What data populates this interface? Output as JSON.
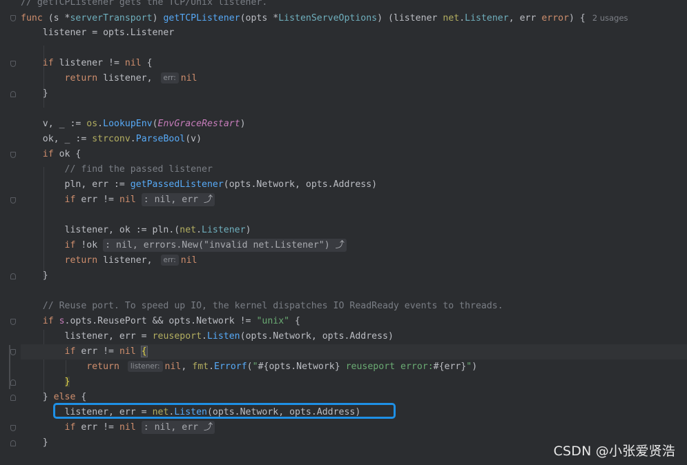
{
  "editor": {
    "lines": [
      {
        "id": "l0",
        "segments": [
          [
            "cm",
            "// getTCPListener gets the TCP/Unix listener."
          ]
        ]
      },
      {
        "id": "l1",
        "segments": [
          [
            "kw",
            "func "
          ],
          [
            "t",
            "(s *"
          ],
          [
            "ty",
            "serverTransport"
          ],
          [
            "t",
            ") "
          ],
          [
            "fn",
            "getTCPListener"
          ],
          [
            "t",
            "(opts *"
          ],
          [
            "ty",
            "ListenServeOptions"
          ],
          [
            "t",
            ") (listener "
          ],
          [
            "pkgname",
            "net"
          ],
          [
            "t",
            "."
          ],
          [
            "ty",
            "Listener"
          ],
          [
            "t",
            ", err "
          ],
          [
            "kw",
            "error"
          ],
          [
            "t",
            ") {"
          ]
        ],
        "usages": "2 usages"
      },
      {
        "id": "l2",
        "segments": [
          [
            "t",
            "    listener = opts.Listener"
          ]
        ]
      },
      {
        "id": "l3",
        "segments": []
      },
      {
        "id": "l4",
        "segments": [
          [
            "t",
            "    "
          ],
          [
            "kw",
            "if "
          ],
          [
            "t",
            "listener != "
          ],
          [
            "kw",
            "nil "
          ],
          [
            "t",
            "{"
          ]
        ]
      },
      {
        "id": "l5",
        "segments": [
          [
            "t",
            "        "
          ],
          [
            "kw",
            "return "
          ],
          [
            "t",
            "listener, "
          ],
          [
            "hint",
            "err:"
          ],
          [
            "kw",
            "nil"
          ]
        ]
      },
      {
        "id": "l6",
        "segments": [
          [
            "t",
            "    }"
          ]
        ]
      },
      {
        "id": "l7",
        "segments": []
      },
      {
        "id": "l8",
        "segments": [
          [
            "t",
            "    v, _ := "
          ],
          [
            "pkgname",
            "os"
          ],
          [
            "t",
            "."
          ],
          [
            "call",
            "LookupEnv"
          ],
          [
            "t",
            "("
          ],
          [
            "cn",
            "EnvGraceRestart"
          ],
          [
            "t",
            ")"
          ]
        ]
      },
      {
        "id": "l9",
        "segments": [
          [
            "t",
            "    ok, _ := "
          ],
          [
            "pkgname",
            "strconv"
          ],
          [
            "t",
            "."
          ],
          [
            "call",
            "ParseBool"
          ],
          [
            "t",
            "(v)"
          ]
        ]
      },
      {
        "id": "l10",
        "segments": [
          [
            "t",
            "    "
          ],
          [
            "kw",
            "if "
          ],
          [
            "t",
            "ok {"
          ]
        ]
      },
      {
        "id": "l11",
        "segments": [
          [
            "t",
            "        "
          ],
          [
            "cm",
            "// find the passed listener"
          ]
        ]
      },
      {
        "id": "l12",
        "segments": [
          [
            "t",
            "        pln, err := "
          ],
          [
            "call",
            "getPassedListener"
          ],
          [
            "t",
            "(opts.Network, opts.Address)"
          ]
        ]
      },
      {
        "id": "l13",
        "segments": [
          [
            "t",
            "        "
          ],
          [
            "kw",
            "if "
          ],
          [
            "t",
            "err != "
          ],
          [
            "kw",
            "nil "
          ],
          [
            "fold",
            ": nil, err ⤴"
          ]
        ]
      },
      {
        "id": "l14",
        "segments": []
      },
      {
        "id": "l15",
        "segments": [
          [
            "t",
            "        listener, ok := pln.("
          ],
          [
            "pkgname",
            "net"
          ],
          [
            "t",
            "."
          ],
          [
            "ty",
            "Listener"
          ],
          [
            "t",
            ")"
          ]
        ]
      },
      {
        "id": "l16",
        "segments": [
          [
            "t",
            "        "
          ],
          [
            "kw",
            "if "
          ],
          [
            "t",
            "!ok "
          ],
          [
            "fold",
            ": nil, errors.New(\"invalid net.Listener\") ⤴"
          ]
        ]
      },
      {
        "id": "l17",
        "segments": [
          [
            "t",
            "        "
          ],
          [
            "kw",
            "return "
          ],
          [
            "t",
            "listener, "
          ],
          [
            "hint",
            "err:"
          ],
          [
            "kw",
            "nil"
          ]
        ]
      },
      {
        "id": "l18",
        "segments": [
          [
            "t",
            "    }"
          ]
        ]
      },
      {
        "id": "l19",
        "segments": []
      },
      {
        "id": "l20",
        "segments": [
          [
            "t",
            "    "
          ],
          [
            "cm",
            "// Reuse port. To speed up IO, the kernel dispatches IO ReadReady events to threads."
          ]
        ]
      },
      {
        "id": "l21",
        "segments": [
          [
            "t",
            "    "
          ],
          [
            "kw",
            "if "
          ],
          [
            "fielddec",
            "s"
          ],
          [
            "t",
            ".opts.ReusePort && opts.Network != "
          ],
          [
            "str",
            "\"unix\""
          ],
          [
            "t",
            " {"
          ]
        ]
      },
      {
        "id": "l22",
        "segments": [
          [
            "t",
            "        listener, err = "
          ],
          [
            "pkgname",
            "reuseport"
          ],
          [
            "t",
            "."
          ],
          [
            "call",
            "Listen"
          ],
          [
            "t",
            "(opts.Network, opts.Address)"
          ]
        ]
      },
      {
        "id": "l23",
        "segments": [
          [
            "t",
            "        "
          ],
          [
            "kw",
            "if "
          ],
          [
            "t",
            "err != "
          ],
          [
            "kw",
            "nil "
          ],
          [
            "brm",
            "{"
          ]
        ],
        "current": true
      },
      {
        "id": "l24",
        "segments": [
          [
            "t",
            "            "
          ],
          [
            "kw",
            "return "
          ],
          [
            "hint",
            "listener:"
          ],
          [
            "kw",
            "nil"
          ],
          [
            "t",
            ", "
          ],
          [
            "pkgname",
            "fmt"
          ],
          [
            "t",
            "."
          ],
          [
            "call",
            "Errorf"
          ],
          [
            "t",
            "("
          ],
          [
            "str",
            "\""
          ],
          [
            "t",
            "#{opts.Network}"
          ],
          [
            "str",
            " reuseport error:"
          ],
          [
            "t",
            "#{err}"
          ],
          [
            "str",
            "\""
          ],
          [
            "t",
            ")"
          ]
        ]
      },
      {
        "id": "l25",
        "segments": [
          [
            "t",
            "        "
          ],
          [
            "bry",
            "}"
          ]
        ]
      },
      {
        "id": "l26",
        "segments": [
          [
            "t",
            "    } "
          ],
          [
            "kw",
            "else "
          ],
          [
            "t",
            "{"
          ]
        ]
      },
      {
        "id": "l27",
        "segments": [
          [
            "t",
            "        listener, err = "
          ],
          [
            "pkgname",
            "net"
          ],
          [
            "t",
            "."
          ],
          [
            "call",
            "Listen"
          ],
          [
            "t",
            "(opts.Network, opts.Address)"
          ]
        ]
      },
      {
        "id": "l28",
        "segments": [
          [
            "t",
            "        "
          ],
          [
            "kw",
            "if "
          ],
          [
            "t",
            "err != "
          ],
          [
            "kw",
            "nil "
          ],
          [
            "fold",
            ": nil, err ⤴"
          ]
        ]
      },
      {
        "id": "l29",
        "segments": [
          [
            "t",
            "    }"
          ]
        ]
      }
    ],
    "folds": [
      {
        "line": 1,
        "dir": "down"
      },
      {
        "line": 4,
        "dir": "down"
      },
      {
        "line": 6,
        "dir": "up"
      },
      {
        "line": 10,
        "dir": "down"
      },
      {
        "line": 13,
        "dir": "down"
      },
      {
        "line": 18,
        "dir": "up"
      },
      {
        "line": 21,
        "dir": "down"
      },
      {
        "line": 23,
        "dir": "down"
      },
      {
        "line": 25,
        "dir": "up"
      },
      {
        "line": 26,
        "dir": "up"
      },
      {
        "line": 28,
        "dir": "down"
      },
      {
        "line": 29,
        "dir": "up"
      }
    ]
  },
  "watermark": "CSDN @小张爱贤浩"
}
